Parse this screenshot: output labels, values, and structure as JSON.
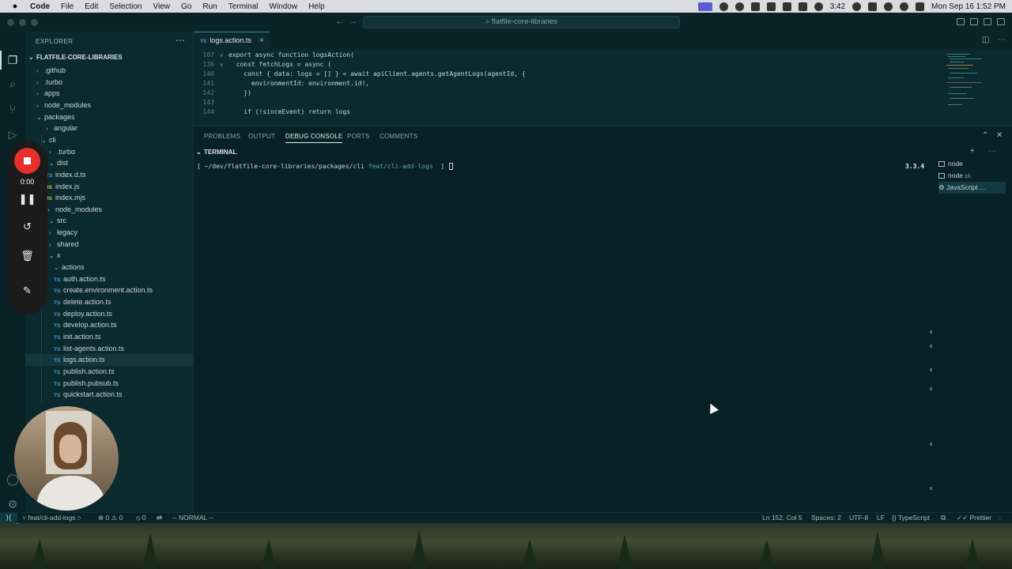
{
  "menubar": {
    "app_name": "Code",
    "items": [
      "File",
      "Edit",
      "Selection",
      "View",
      "Go",
      "Run",
      "Terminal",
      "Window",
      "Help"
    ],
    "battery_time": "3:42",
    "datetime": "Mon Sep 16  1:52 PM"
  },
  "titlebar": {
    "search_text": "flatfile-core-libraries"
  },
  "explorer": {
    "header": "EXPLORER",
    "root": "FLATFILE-CORE-LIBRARIES",
    "rows": [
      {
        "label": ".github",
        "kind": "folder",
        "expanded": false
      },
      {
        "label": ".turbo",
        "kind": "folder",
        "expanded": false
      },
      {
        "label": "apps",
        "kind": "folder",
        "expanded": false
      },
      {
        "label": "node_modules",
        "kind": "folder",
        "expanded": false
      },
      {
        "label": "packages",
        "kind": "folder",
        "expanded": true
      },
      {
        "label": "angular",
        "kind": "folder",
        "expanded": false
      },
      {
        "label": "cli",
        "kind": "folder",
        "expanded": true
      },
      {
        "label": ".turbo",
        "kind": "folder",
        "expanded": false
      },
      {
        "label": "dist",
        "kind": "folder",
        "expanded": true
      },
      {
        "label": "index.d.ts",
        "kind": "ts"
      },
      {
        "label": "index.js",
        "kind": "js"
      },
      {
        "label": "index.mjs",
        "kind": "js"
      },
      {
        "label": "node_modules",
        "kind": "folder",
        "expanded": false
      },
      {
        "label": "src",
        "kind": "folder",
        "expanded": true
      },
      {
        "label": "legacy",
        "kind": "folder",
        "expanded": false
      },
      {
        "label": "shared",
        "kind": "folder",
        "expanded": false
      },
      {
        "label": "x",
        "kind": "folder",
        "expanded": true
      },
      {
        "label": "actions",
        "kind": "folder",
        "expanded": true
      },
      {
        "label": "auth.action.ts",
        "kind": "ts"
      },
      {
        "label": "create.environment.action.ts",
        "kind": "ts"
      },
      {
        "label": "delete.action.ts",
        "kind": "ts"
      },
      {
        "label": "deploy.action.ts",
        "kind": "ts"
      },
      {
        "label": "develop.action.ts",
        "kind": "ts"
      },
      {
        "label": "init.action.ts",
        "kind": "ts"
      },
      {
        "label": "list-agents.action.ts",
        "kind": "ts"
      },
      {
        "label": "logs.action.ts",
        "kind": "ts",
        "selected": true
      },
      {
        "label": "publish.action.ts",
        "kind": "ts"
      },
      {
        "label": "publish.pubsub.ts",
        "kind": "ts"
      },
      {
        "label": "quickstart.action.ts",
        "kind": "ts"
      }
    ]
  },
  "editor": {
    "tab_label": "logs.action.ts",
    "tab_type": "TS",
    "lines": [
      {
        "num": "107",
        "fold": "v",
        "text": "export async function logsAction("
      },
      {
        "num": "136",
        "fold": "v",
        "text": "  const fetchLogs = async ("
      },
      {
        "num": "140",
        "fold": "",
        "text": "    const { data: logs = [] } = await apiClient.agents.getAgentLogs(agentId, {"
      },
      {
        "num": "141",
        "fold": "",
        "text": "      environmentId: environment.id!,"
      },
      {
        "num": "142",
        "fold": "",
        "text": "    })"
      },
      {
        "num": "143",
        "fold": "",
        "text": ""
      },
      {
        "num": "144",
        "fold": "",
        "text": "    if (!sinceEvent) return logs"
      }
    ]
  },
  "panel": {
    "tabs": [
      "PROBLEMS",
      "OUTPUT",
      "DEBUG CONSOLE",
      "PORTS",
      "COMMENTS"
    ],
    "active_tab": "DEBUG CONSOLE",
    "terminal_header": "TERMINAL",
    "prompt_path": "[ ~/dev/flatfile-core-libraries/packages/cli",
    "prompt_branch": "feat/cli-add-logs",
    "prompt_end": "]",
    "node_version": "3.3.4",
    "terminals": [
      {
        "label": "node",
        "sub": ""
      },
      {
        "label": "node",
        "sub": "cli"
      },
      {
        "label": "JavaScript ...",
        "sub": ""
      }
    ]
  },
  "statusbar": {
    "branch": "feat/cli-add-logs",
    "errors": "0",
    "warnings": "0",
    "ports": "0",
    "vim_mode": "-- NORMAL --",
    "position": "Ln 152, Col 5",
    "spaces": "Spaces: 2",
    "encoding": "UTF-8",
    "eol": "LF",
    "language": "TypeScript",
    "formatter": "Prettier"
  },
  "recorder": {
    "time": "0:00"
  },
  "colors": {
    "background": "#0b2a2e",
    "panel": "#072126",
    "record": "#e5302b",
    "ts_icon": "#4f9bd1"
  }
}
